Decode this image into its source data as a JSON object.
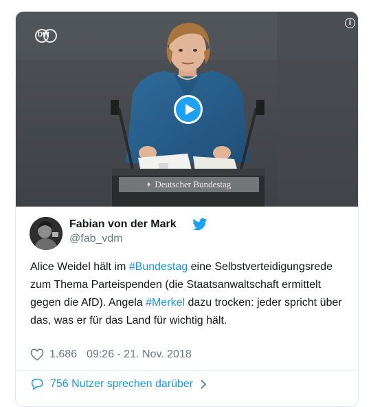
{
  "video": {
    "channel_logo": "DW",
    "sign_text": "Deutscher Bundestag",
    "icons": {
      "play": "play-icon",
      "info": "info-icon",
      "eagle": "eagle-icon"
    },
    "accent": "#1da1f2"
  },
  "author": {
    "name": "Fabian von der Mark",
    "handle": "@fab_vdm",
    "verified_icon": "twitter-bird-icon"
  },
  "tweet": {
    "text_1": "Alice Weidel hält im ",
    "hashtag_1": "#Bundestag",
    "text_2": " eine Selbstverteidigungsrede zum Thema Parteispenden (die Staatsanwaltschaft ermittelt gegen die AfD). Angela ",
    "hashtag_2": "#Merkel",
    "text_3": " dazu trocken: jeder spricht über das, was er für das Land für wichtig hält."
  },
  "meta": {
    "likes": "1.686",
    "timestamp": "09:26 - 21. Nov. 2018"
  },
  "footer": {
    "replies_label": "756 Nutzer sprechen darüber"
  },
  "colors": {
    "link": "#1b95e0",
    "muted": "#657786",
    "text": "#14171a"
  }
}
